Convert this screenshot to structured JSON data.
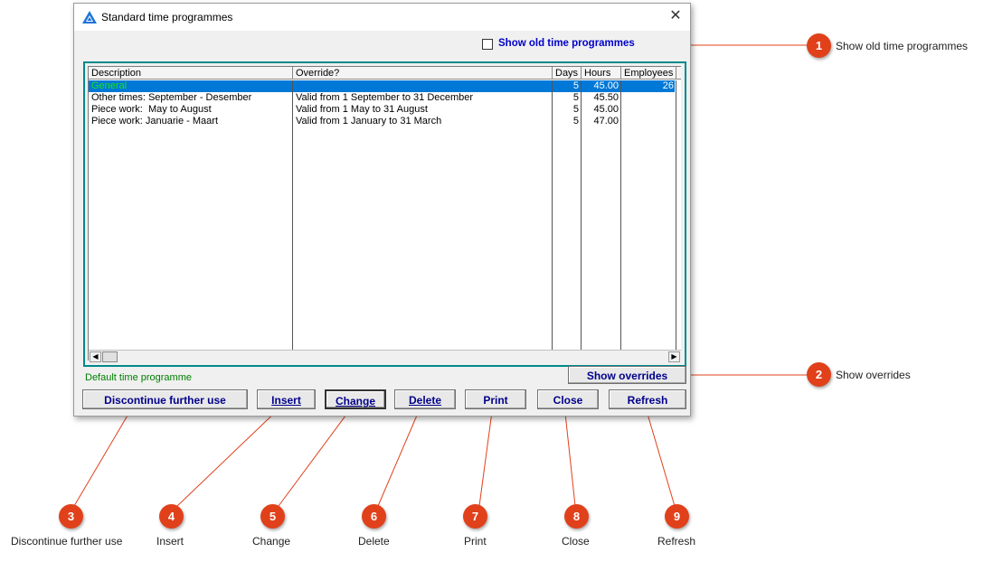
{
  "window": {
    "title": "Standard time programmes",
    "close_glyph": "✕"
  },
  "show_old": {
    "label": "Show old time programmes",
    "checked": false
  },
  "table": {
    "columns": [
      "Description",
      "Override?",
      "Days",
      "Hours",
      "Employees"
    ],
    "rows": [
      {
        "description": "General",
        "override": "",
        "days": "5",
        "hours": "45.00",
        "employees": "26",
        "selected": true
      },
      {
        "description": "Other times: September - Desember",
        "override": "Valid from 1 September to 31 December",
        "days": "5",
        "hours": "45.50",
        "employees": ""
      },
      {
        "description": "Piece work:  May to August",
        "override": "Valid from 1 May to 31 August",
        "days": "5",
        "hours": "45.00",
        "employees": ""
      },
      {
        "description": "Piece work: Januarie - Maart",
        "override": "Valid from 1 January to 31 March",
        "days": "5",
        "hours": "47.00",
        "employees": ""
      }
    ],
    "scroll_left": "◀",
    "scroll_right": "▶"
  },
  "default_label": "Default time programme",
  "buttons": {
    "show_overrides": "Show overrides",
    "discontinue": "Discontinue further use",
    "insert": "Insert",
    "change": "Change",
    "delete": "Delete",
    "print": "Print",
    "close": "Close",
    "refresh": "Refresh"
  },
  "callouts": [
    {
      "num": "1",
      "label": "Show old time programmes"
    },
    {
      "num": "2",
      "label": "Show overrides"
    },
    {
      "num": "3",
      "label": "Discontinue further use"
    },
    {
      "num": "4",
      "label": "Insert"
    },
    {
      "num": "5",
      "label": "Change"
    },
    {
      "num": "6",
      "label": "Delete"
    },
    {
      "num": "7",
      "label": "Print"
    },
    {
      "num": "8",
      "label": "Close"
    },
    {
      "num": "9",
      "label": "Refresh"
    }
  ],
  "colors": {
    "accent": "#0078d7",
    "callout": "#e0411b",
    "button_text": "#00008b",
    "default_text": "#008000",
    "list_border": "#008a8a"
  },
  "icons": {
    "app": "app-logo-icon",
    "close": "close-icon",
    "check": "checkbox-icon"
  }
}
